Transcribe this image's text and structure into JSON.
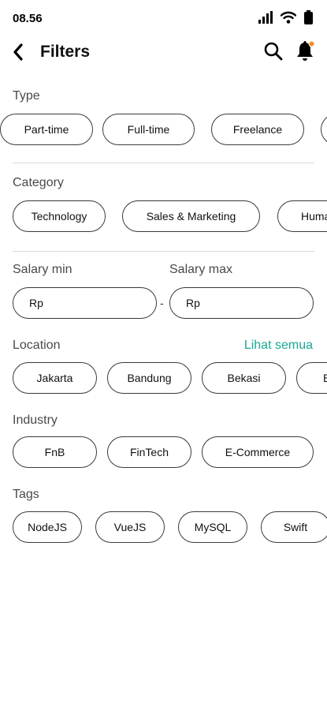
{
  "status": {
    "time": "08.56"
  },
  "header": {
    "title": "Filters"
  },
  "type": {
    "label": "Type",
    "chips": [
      "Part-time",
      "Full-time",
      "Freelance",
      ""
    ]
  },
  "category": {
    "label": "Category",
    "chips": [
      "Technology",
      "Sales & Marketing",
      "Huma"
    ]
  },
  "salary": {
    "min_label": "Salary min",
    "max_label": "Salary max",
    "min_prefix": "Rp",
    "max_prefix": "Rp",
    "separator": "-"
  },
  "location": {
    "label": "Location",
    "see_all": "Lihat semua",
    "chips": [
      "Jakarta",
      "Bandung",
      "Bekasi",
      "B"
    ]
  },
  "industry": {
    "label": "Industry",
    "chips": [
      "FnB",
      "FinTech",
      "E-Commerce"
    ]
  },
  "tags": {
    "label": "Tags",
    "chips": [
      "NodeJS",
      "VueJS",
      "MySQL",
      "Swift"
    ]
  },
  "colors": {
    "accent": "#1aa894",
    "notification_dot": "#f28c28",
    "border": "#3a3a3a",
    "divider": "#d9d9d9"
  },
  "icons": {
    "back": "chevron-left-icon",
    "search": "search-icon",
    "notifications": "bell-icon",
    "signal": "signal-icon",
    "wifi": "wifi-icon",
    "battery": "battery-icon"
  }
}
